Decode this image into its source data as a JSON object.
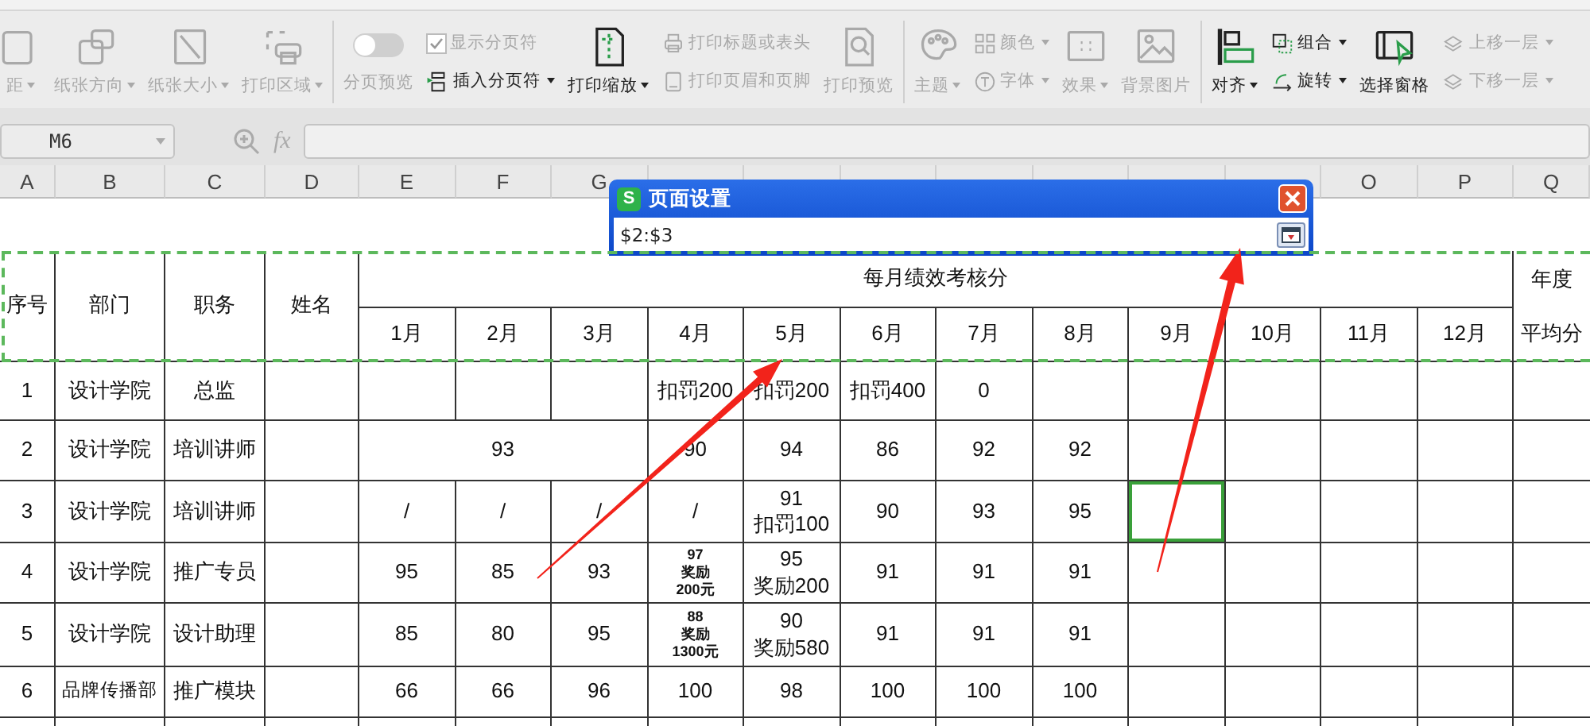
{
  "ribbon": {
    "groups": [
      [
        {
          "label": "距",
          "kind": "large",
          "disabled": true,
          "has_menu": true
        },
        {
          "label": "纸张方向",
          "kind": "large",
          "disabled": true,
          "has_menu": true
        },
        {
          "label": "纸张大小",
          "kind": "large",
          "disabled": true,
          "has_menu": true
        },
        {
          "label": "打印区域",
          "kind": "large",
          "disabled": true,
          "has_menu": true
        }
      ],
      [
        {
          "label": "分页预览",
          "kind": "toggle",
          "disabled": true,
          "on": false
        },
        {
          "label": "显示分页符",
          "kind": "checkbox",
          "disabled": true,
          "checked": true
        },
        {
          "label": "插入分页符",
          "kind": "small",
          "disabled": false,
          "has_menu": true
        },
        {
          "label": "打印缩放",
          "kind": "large",
          "disabled": false,
          "has_menu": true
        },
        {
          "label": "打印标题或表头",
          "kind": "small",
          "disabled": true,
          "has_menu": false
        },
        {
          "label": "打印页眉和页脚",
          "kind": "small",
          "disabled": true,
          "has_menu": false
        },
        {
          "label": "打印预览",
          "kind": "large",
          "disabled": true,
          "has_menu": false
        }
      ],
      [
        {
          "label": "主题",
          "kind": "large",
          "disabled": true,
          "has_menu": true
        },
        {
          "label": "颜色",
          "kind": "small",
          "disabled": true,
          "has_menu": true
        },
        {
          "label": "字体",
          "kind": "small",
          "disabled": true,
          "has_menu": true
        },
        {
          "label": "效果",
          "kind": "large",
          "disabled": true,
          "has_menu": true
        },
        {
          "label": "背景图片",
          "kind": "large",
          "disabled": true,
          "has_menu": false
        }
      ],
      [
        {
          "label": "对齐",
          "kind": "large",
          "disabled": false,
          "has_menu": true
        },
        {
          "label": "组合",
          "kind": "small",
          "disabled": false,
          "has_menu": true
        },
        {
          "label": "旋转",
          "kind": "small",
          "disabled": false,
          "has_menu": true
        },
        {
          "label": "选择窗格",
          "kind": "large",
          "disabled": false,
          "has_menu": false
        },
        {
          "label": "上移一层",
          "kind": "small",
          "disabled": true,
          "has_menu": true
        },
        {
          "label": "下移一层",
          "kind": "small",
          "disabled": true,
          "has_menu": true
        }
      ]
    ]
  },
  "formula_bar": {
    "name_box": "M6",
    "function_label": "fx"
  },
  "sheet": {
    "column_headers_left": [
      "A",
      "B",
      "C",
      "D",
      "E",
      "F",
      "G"
    ],
    "column_headers_right": [
      "O",
      "P",
      "Q"
    ],
    "header": {
      "fixed_columns": [
        "序号",
        "部门",
        "职务",
        "姓名"
      ],
      "group_title": "每月绩效考核分",
      "months": [
        "1月",
        "2月",
        "3月",
        "4月",
        "5月",
        "6月",
        "7月",
        "8月",
        "9月",
        "10月",
        "11月",
        "12月"
      ],
      "annual_title": "年度",
      "annual_subtitle": "平均分"
    },
    "rows": [
      {
        "cells": [
          "1",
          "设计学院",
          "总监",
          "",
          "",
          "",
          "",
          "扣罚200",
          "扣罚200",
          "扣罚400",
          "0",
          "",
          "",
          "",
          "",
          "",
          ""
        ]
      },
      {
        "cells": [
          "2",
          "设计学院",
          "培训讲师",
          "",
          {
            "text": "93",
            "colspan": 3
          },
          "90",
          "94",
          "86",
          "92",
          "92",
          "",
          "",
          "",
          "",
          ""
        ]
      },
      {
        "cells": [
          "3",
          "设计学院",
          "培训讲师",
          "",
          "/",
          "/",
          "/",
          "/",
          "91\n扣罚100",
          "90",
          "93",
          "95",
          {
            "text": "",
            "selected": true
          },
          "",
          "",
          "",
          ""
        ]
      },
      {
        "cells": [
          "4",
          "设计学院",
          "推广专员",
          "",
          "95",
          "85",
          "93",
          {
            "text": "97\n奖励\n200元",
            "kind": "note"
          },
          "95\n奖励200",
          "91",
          "91",
          "91",
          "",
          "",
          "",
          "",
          ""
        ]
      },
      {
        "cells": [
          "5",
          "设计学院",
          "设计助理",
          "",
          "85",
          "80",
          "95",
          {
            "text": "88\n奖励\n1300元",
            "kind": "note"
          },
          "90\n奖励580",
          "91",
          "91",
          "91",
          "",
          "",
          "",
          "",
          ""
        ]
      },
      {
        "cells": [
          "6",
          {
            "text": "品牌传播部",
            "kind": "compact"
          },
          "推广模块",
          "",
          "66",
          "66",
          "96",
          "100",
          "98",
          "100",
          "100",
          "100",
          "",
          "",
          "",
          "",
          ""
        ]
      }
    ]
  },
  "dialog": {
    "app_badge": "S",
    "title": "页面设置",
    "value": "$2:$3"
  },
  "annotations": [
    {
      "kind": "arrow"
    },
    {
      "kind": "arrow"
    }
  ]
}
